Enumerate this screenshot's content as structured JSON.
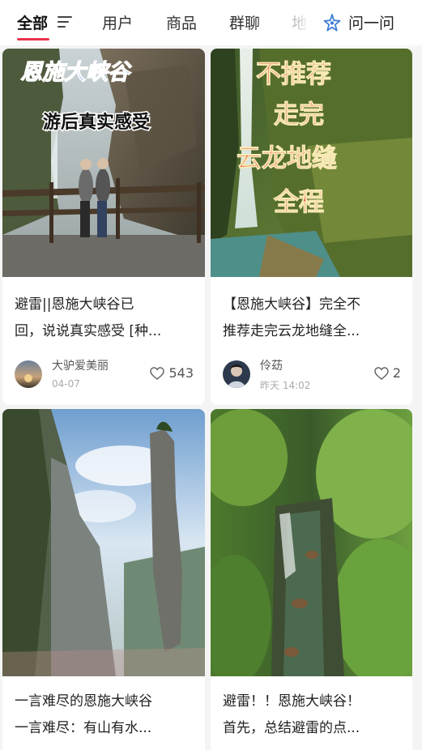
{
  "nav": {
    "tabs": [
      {
        "label": "全部",
        "active": true
      },
      {
        "label": "用户"
      },
      {
        "label": "商品"
      },
      {
        "label": "群聊"
      },
      {
        "label": "地"
      }
    ],
    "filter_icon": "filter-icon",
    "ask_label": "问一问",
    "ask_icon": "sparkle-icon",
    "accent_color": "#e8344a"
  },
  "cards": [
    {
      "cover_text": [
        "恩施大峡谷",
        "游后真实感受"
      ],
      "title_lines": [
        "避雷||恩施大峡谷已",
        "回，说说真实感受 [种..."
      ],
      "author": "大驴爱美丽",
      "date": "04-07",
      "likes": "543"
    },
    {
      "cover_text": [
        "不推荐",
        "走完",
        "云龙地缝",
        "全程"
      ],
      "title_lines": [
        "【恩施大峡谷】完全不",
        "推荐走完云龙地缝全..."
      ],
      "author": "伶苭",
      "date": "昨天 14:02",
      "likes": "2"
    },
    {
      "title_lines": [
        "一言难尽的恩施大峡谷",
        "一言难尽：有山有水..."
      ]
    },
    {
      "title_lines": [
        "避雷！！恩施大峡谷！",
        "首先，总结避雷的点..."
      ]
    }
  ]
}
